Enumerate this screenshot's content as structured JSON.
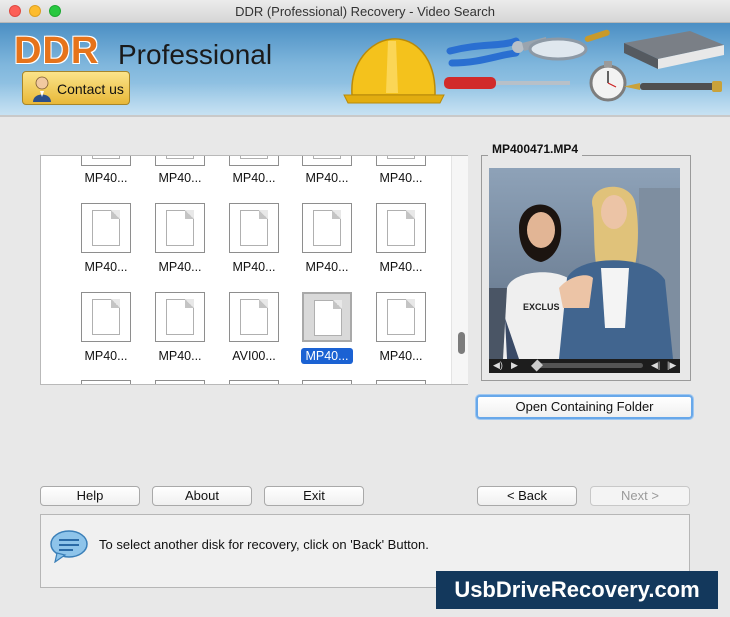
{
  "window": {
    "title": "DDR (Professional) Recovery - Video Search"
  },
  "header": {
    "logo_ddr": "DDR",
    "logo_professional": "Professional",
    "contact_label": "Contact us"
  },
  "grid": {
    "rows": [
      [
        "MP40...",
        "MP40...",
        "MP40...",
        "MP40...",
        "MP40..."
      ],
      [
        "MP40...",
        "MP40...",
        "MP40...",
        "MP40...",
        "MP40..."
      ],
      [
        "MP40...",
        "MP40...",
        "AVI00...",
        "MP40...",
        "MP40..."
      ]
    ],
    "selected": "MP40..."
  },
  "preview": {
    "filename": "MP400471.MP4",
    "open_folder_label": "Open Containing Folder",
    "image": "two-women-photo"
  },
  "buttons": {
    "help": "Help",
    "about": "About",
    "exit": "Exit",
    "back": "< Back",
    "next": "Next >"
  },
  "message": {
    "text": "To select another disk for recovery, click on 'Back' Button.",
    "icon": "speech-bubble-icon"
  },
  "watermark": "UsbDriveRecovery.com",
  "colors": {
    "logo_orange": "#e6731a",
    "selection_blue": "#1b62d3",
    "watermark_bg": "#13385c"
  }
}
